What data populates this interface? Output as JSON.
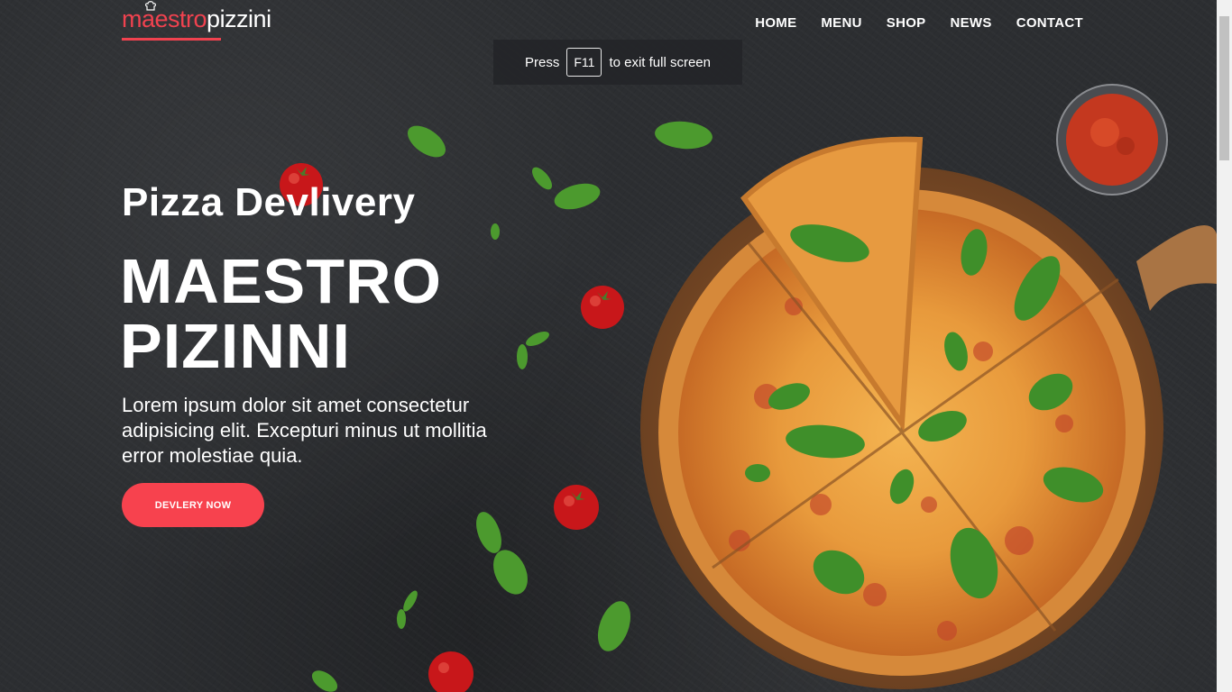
{
  "header": {
    "logo_part1": "maestro",
    "logo_part2": "pizzini",
    "nav": [
      "HOME",
      "MENU",
      "SHOP",
      "NEWS",
      "CONTACT"
    ]
  },
  "fullscreen_toast": {
    "prefix": "Press",
    "key": "F11",
    "suffix": "to exit full screen"
  },
  "hero": {
    "subtitle": "Pizza Devlivery",
    "title_line1": "MAESTRO",
    "title_line2": "PIZINNI",
    "description": "Lorem ipsum dolor sit amet consectetur adipisicing elit. Excepturi minus ut mollitia error molestiae quia.",
    "cta_label": "DEVLERY NOW"
  },
  "colors": {
    "accent": "#f7424e",
    "background": "#2c2e31",
    "text": "#ffffff"
  },
  "icons": [
    "chef-hat-icon",
    "pizza-image",
    "sauce-bowl-image",
    "tomato-image",
    "basil-leaf-image"
  ]
}
